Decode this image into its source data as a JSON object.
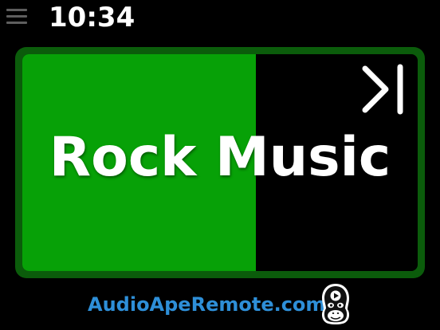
{
  "header": {
    "menu_icon": "hamburger-menu-icon",
    "time": "10:34"
  },
  "player": {
    "title": "Rock Music",
    "progress_fraction": 0.59,
    "skip_icon": "skip-next-icon",
    "colors": {
      "frame": "#0b5c0b",
      "progress": "#07a107",
      "background": "#000000",
      "title_text": "#ffffff"
    }
  },
  "footer": {
    "link_text": "AudioApeRemote.com",
    "link_color": "#2e8fd8",
    "logo_icon": "ape-logo-icon"
  }
}
